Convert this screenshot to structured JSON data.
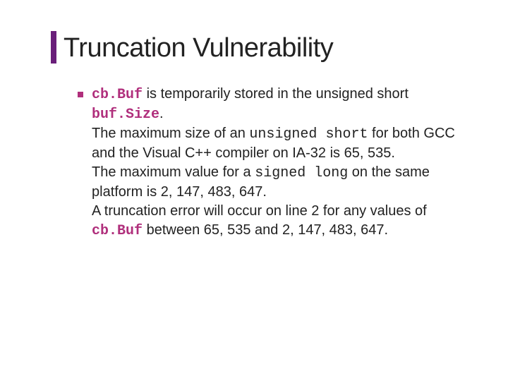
{
  "slide": {
    "title": "Truncation Vulnerability",
    "cbBuf": "cb.Buf",
    "p1_a": " is temporarily stored in the unsigned short ",
    "bufSize": "buf.Size",
    "p1_b": ".",
    "p2_a": "The maximum size of an ",
    "unsignedShort": "unsigned short",
    "p2_b": " for both GCC and the Visual C++ compiler on IA-32 is 65, 535.",
    "p3_a": "The maximum value for a ",
    "signedLong": "signed long",
    "p3_b": " on the same platform is 2, 147, 483, 647.",
    "p4_a": "A truncation error will occur on line 2 for any values of ",
    "p4_b": " between 65, 535 and 2, 147, 483, 647."
  }
}
